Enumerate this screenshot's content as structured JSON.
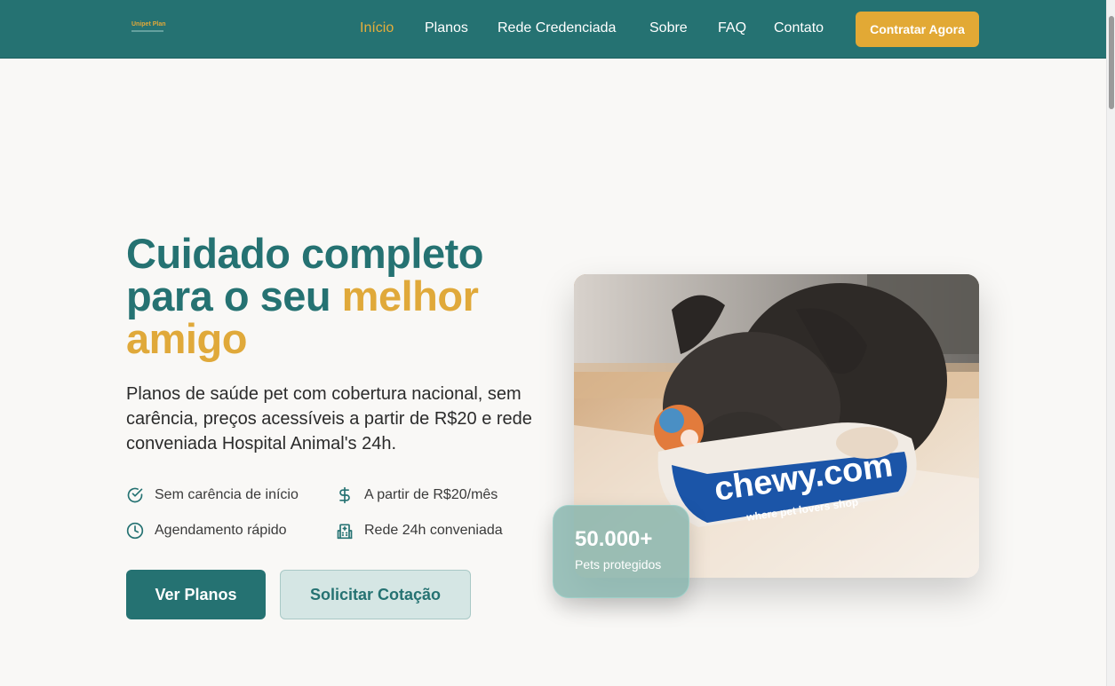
{
  "header": {
    "logo_text": "Unipet Plan",
    "nav": [
      {
        "label": "Início",
        "active": true
      },
      {
        "label": "Planos"
      },
      {
        "label": "Rede Credenciada"
      },
      {
        "label": "Sobre"
      },
      {
        "label": "FAQ"
      },
      {
        "label": "Contato"
      }
    ],
    "cta_label": "Contratar Agora"
  },
  "hero": {
    "title_part1": "Cuidado completo para o seu ",
    "title_accent": "melhor amigo",
    "description": "Planos de saúde pet com cobertura nacional, sem carência, preços acessíveis a partir de R$20 e rede conveniada Hospital Animal's 24h.",
    "features": [
      {
        "label": "Sem carência de início",
        "icon": "check-circle-icon"
      },
      {
        "label": "A partir de R$20/mês",
        "icon": "dollar-icon"
      },
      {
        "label": "Agendamento rápido",
        "icon": "clock-icon"
      },
      {
        "label": "Rede 24h conveniada",
        "icon": "hospital-icon"
      }
    ],
    "primary_button": "Ver Planos",
    "secondary_button": "Solicitar Cotação",
    "image_label": "chewy.com",
    "image_tagline": "where pet lovers shop",
    "stat_value": "50.000+",
    "stat_label": "Pets protegidos"
  },
  "colors": {
    "primary": "#257272",
    "accent": "#e0a93a",
    "background": "#f9f8f6"
  }
}
